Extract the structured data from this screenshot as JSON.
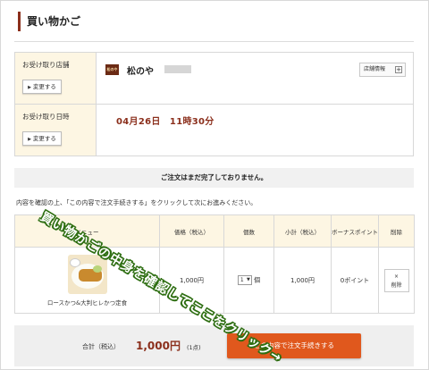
{
  "page": {
    "title": "買い物かご"
  },
  "pickup": {
    "store_label": "お受け取り店舗",
    "time_label": "お受け取り日時",
    "change_button": "変更する",
    "store_logo": "松のや",
    "store_name": "松のや",
    "store_info_button": "店舗情報",
    "pickup_time": "04月26日　11時30分"
  },
  "notice": "ご注文はまだ完了しておりません。",
  "confirm_text": "内容を確認の上、「この内容で注文手続きする」をクリックして次にお進みください。",
  "cart": {
    "headers": [
      "メニュー",
      "価格（税込）",
      "個数",
      "小計（税込）",
      "ボーナスポイント",
      "削除"
    ],
    "item": {
      "name": "ロースかつ&大判ヒレかつ定食",
      "price": "1,000円",
      "quantity": "1",
      "quantity_unit": "個",
      "subtotal": "1,000円",
      "bonus_points": "0ポイント",
      "delete_label": "削除",
      "delete_icon_glyph": "×"
    }
  },
  "summary": {
    "total_label": "合計（税込）",
    "total_amount": "1,000円",
    "item_count": "(1点)",
    "checkout_button": "この内容で注文手続きする"
  },
  "annotation": "買い物かごの中身を確認してここをクリック→",
  "colors": {
    "accent": "#8b2f1c",
    "checkout": "#e0581d",
    "label_bg": "#fdf6e3",
    "annotation_outline": "#2e6e12"
  },
  "icons": [
    "store-logo",
    "plus-icon",
    "dropdown-arrow-icon",
    "close-icon",
    "chevron-right-icon"
  ]
}
